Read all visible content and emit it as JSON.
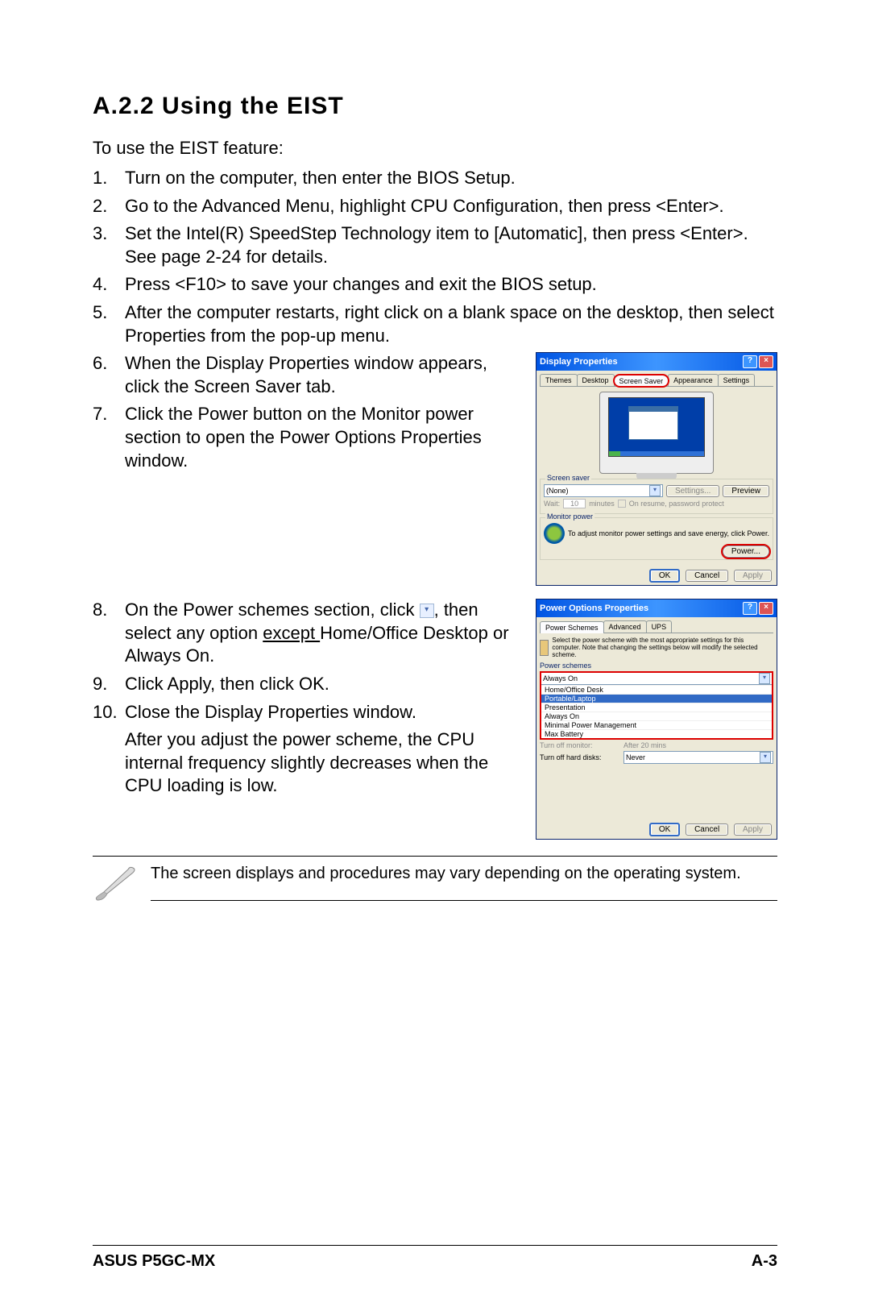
{
  "heading": "A.2.2  Using the EIST",
  "intro": "To use the EIST feature:",
  "steps": [
    {
      "n": "1.",
      "t": "Turn on the computer, then enter the BIOS Setup."
    },
    {
      "n": "2.",
      "t": "Go to the Advanced Menu, highlight CPU Configuration, then press <Enter>."
    },
    {
      "n": "3.",
      "t": "Set the Intel(R) SpeedStep Technology item to [Automatic], then press <Enter>. See page 2-24 for details."
    },
    {
      "n": "4.",
      "t": "Press <F10> to save your changes and exit the BIOS setup."
    },
    {
      "n": "5.",
      "t": "After the computer restarts, right click on a blank space on the desktop, then select Properties from the pop-up menu."
    }
  ],
  "steps_b": [
    {
      "n": "6.",
      "t": "When the Display Properties window appears, click the Screen Saver tab."
    },
    {
      "n": "7.",
      "t": "Click the Power button on the Monitor power section to open the Power Options Properties window."
    }
  ],
  "steps_c": [
    {
      "n": "8.",
      "t1": "On the Power schemes section, click ",
      "t2": ", then select any option ",
      "t3": "except ",
      "t4": "Home/Office Desktop or Always On."
    },
    {
      "n": "9.",
      "t": "Click Apply, then click OK."
    },
    {
      "n": "10.",
      "t": "Close the Display Properties window."
    }
  ],
  "after_text": "After you adjust the power scheme, the CPU internal frequency slightly decreases when the CPU loading is low.",
  "note": "The screen displays and procedures may vary depending on the operating system.",
  "footer_left": "ASUS P5GC-MX",
  "footer_right": "A-3",
  "dialog1": {
    "title": "Display Properties",
    "tabs": [
      "Themes",
      "Desktop",
      "Screen Saver",
      "Appearance",
      "Settings"
    ],
    "screensaver_label": "Screen saver",
    "screensaver_value": "(None)",
    "settings_btn": "Settings...",
    "preview_btn": "Preview",
    "wait_label": "Wait:",
    "wait_value": "10",
    "wait_units": "minutes",
    "resume_check": "On resume, password protect",
    "monitor_label": "Monitor power",
    "monitor_text": "To adjust monitor power settings and save energy, click Power.",
    "power_btn": "Power...",
    "ok": "OK",
    "cancel": "Cancel",
    "apply": "Apply"
  },
  "dialog2": {
    "title": "Power Options Properties",
    "tabs": [
      "Power Schemes",
      "Advanced",
      "UPS"
    ],
    "desc": "Select the power scheme with the most appropriate settings for this computer. Note that changing the settings below will modify the selected scheme.",
    "ps_label": "Power schemes",
    "ps_value": "Always On",
    "ps_options": [
      "Home/Office Desk",
      "Portable/Laptop",
      "Presentation",
      "Always On",
      "Minimal Power Management",
      "Max Battery"
    ],
    "turnoff_monitor_label": "Turn off monitor:",
    "turnoff_monitor_value": "After 20 mins",
    "turnoff_hd_label": "Turn off hard disks:",
    "turnoff_hd_value": "Never",
    "ok": "OK",
    "cancel": "Cancel",
    "apply": "Apply"
  }
}
